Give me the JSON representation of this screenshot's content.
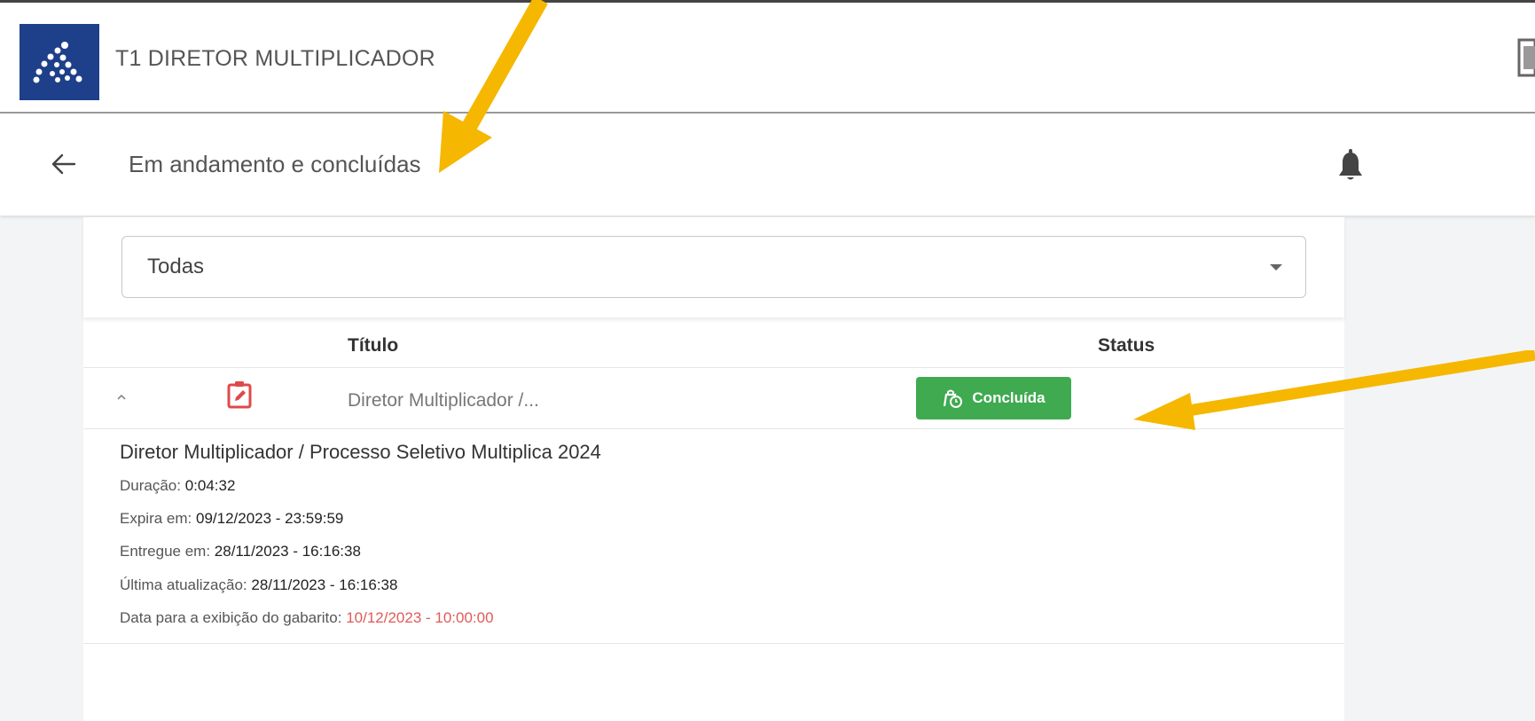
{
  "header": {
    "app_title": "T1 DIRETOR MULTIPLICADOR",
    "brand_color": "#1e3f8a"
  },
  "subheader": {
    "title": "Em andamento e concluídas"
  },
  "filter": {
    "selected": "Todas"
  },
  "table": {
    "col_title": "Título",
    "col_status": "Status",
    "row": {
      "title_short": "Diretor Multiplicador /...",
      "status": "Concluída",
      "status_color": "#3faa50",
      "title_full": "Diretor Multiplicador / Processo Seletivo Multiplica 2024",
      "details": {
        "duracao_label": "Duração:",
        "duracao_value": "0:04:32",
        "expira_label": "Expira em:",
        "expira_value": "09/12/2023 - 23:59:59",
        "entregue_label": "Entregue em:",
        "entregue_value": "28/11/2023 - 16:16:38",
        "atualizacao_label": "Última atualização:",
        "atualizacao_value": "28/11/2023 - 16:16:38",
        "gabarito_label": "Data para a exibição do gabarito:",
        "gabarito_value": "10/12/2023 - 10:00:00"
      }
    }
  }
}
